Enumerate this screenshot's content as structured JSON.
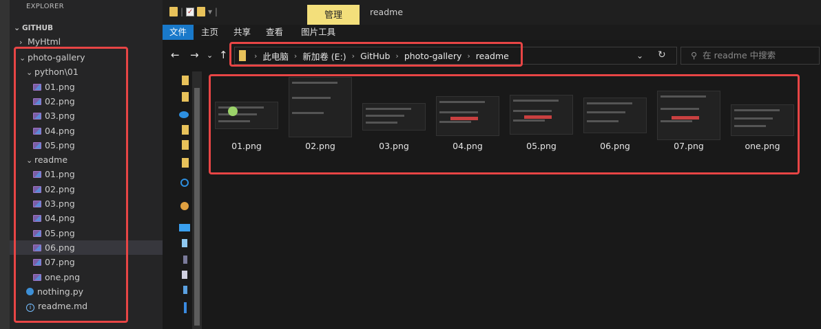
{
  "vscode": {
    "header": "EXPLORER",
    "section": "GITHUB",
    "tree": [
      {
        "label": "MyHtml",
        "type": "folder-collapsed",
        "indent": 0
      },
      {
        "label": "photo-gallery",
        "type": "folder-open",
        "indent": 0
      },
      {
        "label": "python\\01",
        "type": "folder-open",
        "indent": 1
      },
      {
        "label": "01.png",
        "type": "image",
        "indent": 2
      },
      {
        "label": "02.png",
        "type": "image",
        "indent": 2
      },
      {
        "label": "03.png",
        "type": "image",
        "indent": 2
      },
      {
        "label": "04.png",
        "type": "image",
        "indent": 2
      },
      {
        "label": "05.png",
        "type": "image",
        "indent": 2
      },
      {
        "label": "readme",
        "type": "folder-open",
        "indent": 1
      },
      {
        "label": "01.png",
        "type": "image",
        "indent": 2
      },
      {
        "label": "02.png",
        "type": "image",
        "indent": 2
      },
      {
        "label": "03.png",
        "type": "image",
        "indent": 2
      },
      {
        "label": "04.png",
        "type": "image",
        "indent": 2
      },
      {
        "label": "05.png",
        "type": "image",
        "indent": 2
      },
      {
        "label": "06.png",
        "type": "image",
        "indent": 2,
        "selected": true
      },
      {
        "label": "07.png",
        "type": "image",
        "indent": 2
      },
      {
        "label": "one.png",
        "type": "image",
        "indent": 2
      },
      {
        "label": "nothing.py",
        "type": "python",
        "indent": 1
      },
      {
        "label": "readme.md",
        "type": "info",
        "indent": 1
      }
    ]
  },
  "explorer": {
    "title": "readme",
    "manage_tab": "管理",
    "ribbon_tabs": [
      "文件",
      "主页",
      "共享",
      "查看",
      "图片工具"
    ],
    "breadcrumb": [
      "此电脑",
      "新加卷 (E:)",
      "GitHub",
      "photo-gallery",
      "readme"
    ],
    "search_placeholder": "在 readme 中搜索",
    "files": [
      "01.png",
      "02.png",
      "03.png",
      "04.png",
      "05.png",
      "06.png",
      "07.png",
      "one.png"
    ]
  },
  "colors": {
    "highlight": "#e84545",
    "accent": "#1979ca",
    "manage": "#f3df7b"
  }
}
